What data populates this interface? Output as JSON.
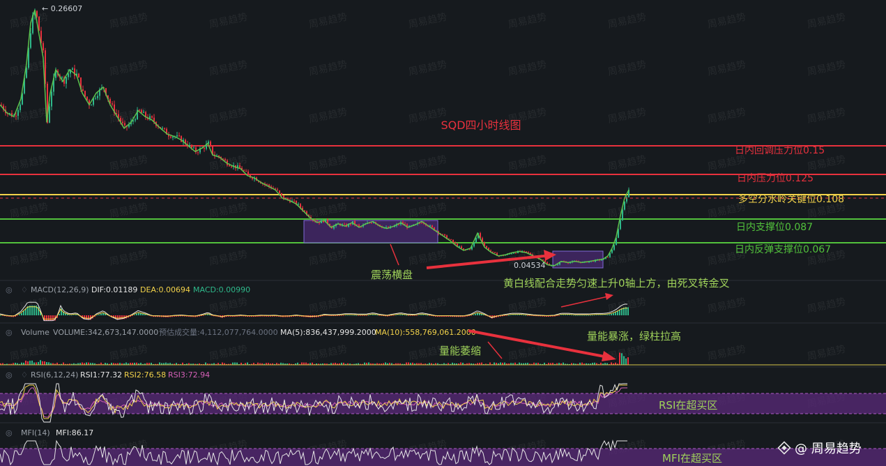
{
  "chart_data": {
    "type": "candlestick",
    "title": "SQD四小时线图",
    "high_label": "← 0.26607",
    "low_label": "0.04534",
    "level_lines": [
      {
        "label": "日内回调压力位0.15",
        "value": 0.15,
        "color": "#e8313d"
      },
      {
        "label": "日内压力位0.125",
        "value": 0.125,
        "color": "#e8313d"
      },
      {
        "label": "多空分水岭关键位0.108",
        "value": 0.108,
        "color": "#f2d24a"
      },
      {
        "label": "日内支撑位0.087",
        "value": 0.087,
        "color": "#52c23c"
      },
      {
        "label": "日内反弹支撑位0.067",
        "value": 0.067,
        "color": "#52c23c"
      }
    ],
    "annotations": {
      "range": "震荡横盘",
      "macd_note": "黄白线配合走势匀速上升0轴上方，由死叉转金叉",
      "vol_burst": "量能暴涨，绿柱拉高",
      "vol_shrink": "量能萎缩",
      "rsi_note": "RSI在超买区",
      "mfi_note": "MFI在超买区"
    },
    "macd": {
      "name": "MACD(12,26,9)",
      "dif": "DIF:0.01189",
      "dea": "DEA:0.00694",
      "macd": "MACD:0.00990"
    },
    "volume": {
      "name": "Volume",
      "volume": "VOLUME:342,673,147.0000",
      "est": "预估成交量:4,112,077,764.0000",
      "ma5": "MA(5):836,437,999.2000",
      "ma10": "MA(10):558,769,061.2000"
    },
    "rsi": {
      "name": "RSI(6,12,24)",
      "rsi1": "RSI1:77.32",
      "rsi2": "RSI2:76.58",
      "rsi3": "RSI3:72.94"
    },
    "mfi": {
      "name": "MFI(14)",
      "mfi": "MFI:86.17"
    },
    "price_path": [
      [
        0,
        0.185
      ],
      [
        10,
        0.178
      ],
      [
        20,
        0.175
      ],
      [
        30,
        0.19
      ],
      [
        38,
        0.22
      ],
      [
        44,
        0.255
      ],
      [
        50,
        0.266
      ],
      [
        56,
        0.245
      ],
      [
        62,
        0.225
      ],
      [
        67,
        0.17
      ],
      [
        72,
        0.195
      ],
      [
        80,
        0.215
      ],
      [
        90,
        0.205
      ],
      [
        100,
        0.215
      ],
      [
        110,
        0.21
      ],
      [
        118,
        0.195
      ],
      [
        128,
        0.185
      ],
      [
        138,
        0.195
      ],
      [
        148,
        0.2
      ],
      [
        158,
        0.185
      ],
      [
        168,
        0.175
      ],
      [
        178,
        0.165
      ],
      [
        188,
        0.17
      ],
      [
        198,
        0.18
      ],
      [
        208,
        0.175
      ],
      [
        218,
        0.172
      ],
      [
        230,
        0.165
      ],
      [
        240,
        0.16
      ],
      [
        250,
        0.158
      ],
      [
        260,
        0.155
      ],
      [
        270,
        0.15
      ],
      [
        280,
        0.145
      ],
      [
        290,
        0.148
      ],
      [
        298,
        0.152
      ],
      [
        305,
        0.142
      ],
      [
        315,
        0.14
      ],
      [
        325,
        0.135
      ],
      [
        335,
        0.132
      ],
      [
        345,
        0.13
      ],
      [
        355,
        0.124
      ],
      [
        365,
        0.122
      ],
      [
        375,
        0.118
      ],
      [
        385,
        0.115
      ],
      [
        395,
        0.112
      ],
      [
        405,
        0.105
      ],
      [
        415,
        0.103
      ],
      [
        425,
        0.1
      ],
      [
        435,
        0.094
      ],
      [
        445,
        0.088
      ],
      [
        455,
        0.084
      ],
      [
        465,
        0.086
      ],
      [
        475,
        0.08
      ],
      [
        485,
        0.083
      ],
      [
        495,
        0.081
      ],
      [
        505,
        0.084
      ],
      [
        515,
        0.08
      ],
      [
        525,
        0.083
      ],
      [
        535,
        0.085
      ],
      [
        545,
        0.081
      ],
      [
        555,
        0.079
      ],
      [
        565,
        0.081
      ],
      [
        575,
        0.084
      ],
      [
        585,
        0.08
      ],
      [
        595,
        0.082
      ],
      [
        605,
        0.085
      ],
      [
        615,
        0.081
      ],
      [
        625,
        0.077
      ],
      [
        635,
        0.073
      ],
      [
        645,
        0.069
      ],
      [
        655,
        0.064
      ],
      [
        665,
        0.06
      ],
      [
        675,
        0.062
      ],
      [
        685,
        0.075
      ],
      [
        695,
        0.063
      ],
      [
        705,
        0.058
      ],
      [
        715,
        0.055
      ],
      [
        725,
        0.056
      ],
      [
        735,
        0.058
      ],
      [
        745,
        0.059
      ],
      [
        755,
        0.058
      ],
      [
        765,
        0.055
      ],
      [
        775,
        0.052
      ],
      [
        785,
        0.047
      ],
      [
        795,
        0.046
      ],
      [
        805,
        0.05
      ],
      [
        815,
        0.049
      ],
      [
        825,
        0.05
      ],
      [
        835,
        0.049
      ],
      [
        845,
        0.05
      ],
      [
        855,
        0.051
      ],
      [
        865,
        0.052
      ],
      [
        872,
        0.055
      ],
      [
        878,
        0.062
      ],
      [
        884,
        0.072
      ],
      [
        890,
        0.09
      ],
      [
        896,
        0.105
      ],
      [
        902,
        0.112
      ]
    ]
  },
  "watermark": "周易趋势",
  "brand": {
    "name": "@ 周易趋势"
  },
  "colors": {
    "up": "#2eb88a",
    "down": "#e8313d",
    "purple": "#5a2a7a",
    "bg": "#161a1e"
  }
}
